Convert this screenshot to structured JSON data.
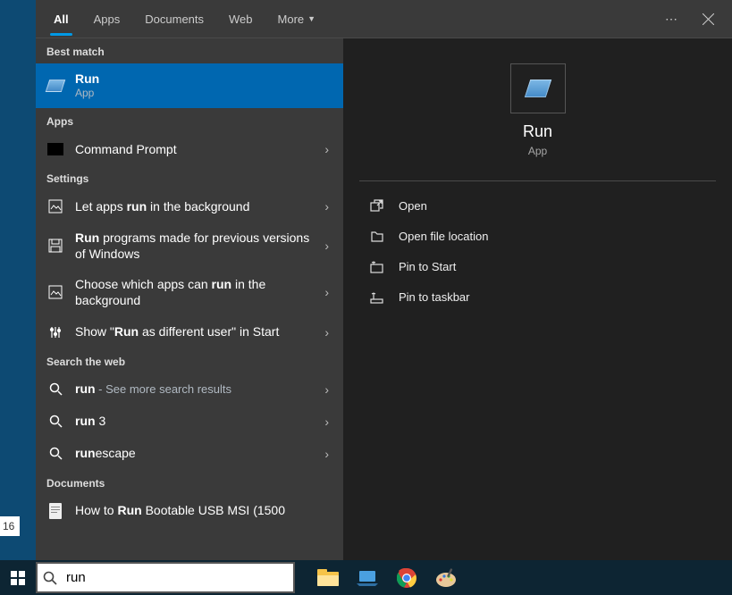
{
  "tabs": {
    "all": "All",
    "apps": "Apps",
    "documents": "Documents",
    "web": "Web",
    "more": "More"
  },
  "sections": {
    "best_match": "Best match",
    "apps": "Apps",
    "settings": "Settings",
    "search_web": "Search the web",
    "documents": "Documents"
  },
  "best": {
    "title": "Run",
    "type": "App"
  },
  "apps_list": [
    {
      "text": "Command Prompt"
    }
  ],
  "settings_list": [
    {
      "pre": "Let apps ",
      "bold": "run",
      "post": " in the background"
    },
    {
      "boldpre": "Run",
      "post": " programs made for previous versions of Windows"
    },
    {
      "pre": "Choose which apps can ",
      "bold": "run",
      "post": " in the background"
    },
    {
      "pre": "Show \"",
      "bold": "Run",
      "post": " as different user\" in Start"
    }
  ],
  "web_list": [
    {
      "bold": "run",
      "post": "",
      "muted": " - See more search results"
    },
    {
      "bold": "run",
      "post": " 3"
    },
    {
      "bold": "run",
      "post": "escape"
    }
  ],
  "doc_list": [
    {
      "pre": "How to ",
      "bold": "Run",
      "post": " Bootable USB MSI (1500"
    }
  ],
  "preview": {
    "title": "Run",
    "type": "App",
    "actions": {
      "open": "Open",
      "open_loc": "Open file location",
      "pin_start": "Pin to Start",
      "pin_taskbar": "Pin to taskbar"
    }
  },
  "search": {
    "value": "run"
  },
  "left_edge": "16"
}
